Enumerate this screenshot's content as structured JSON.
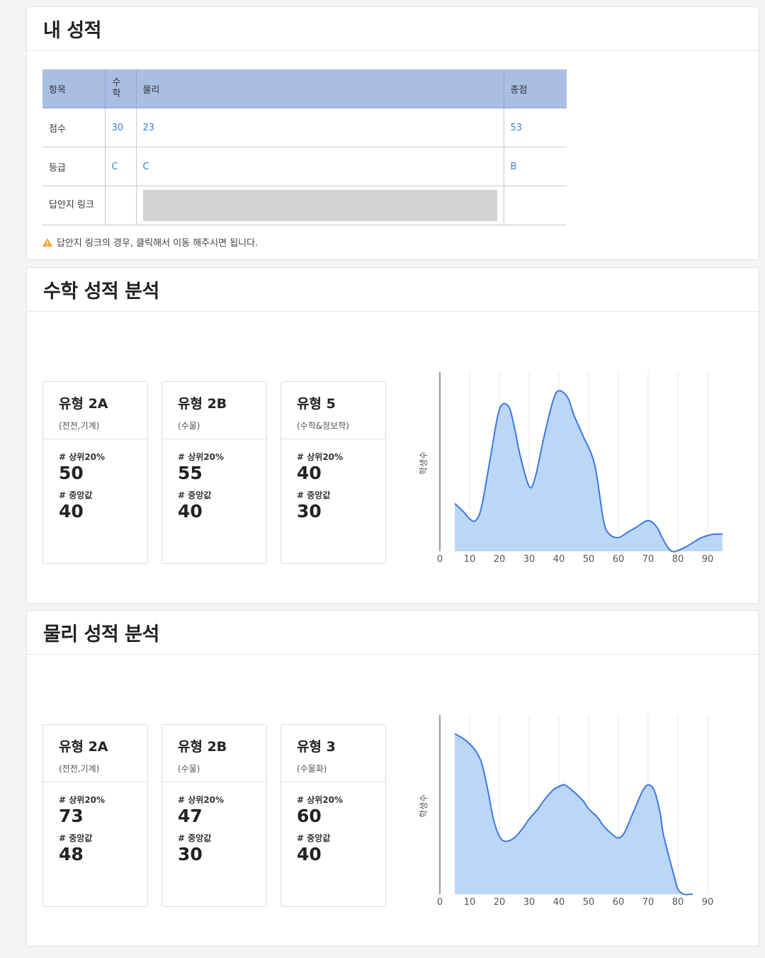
{
  "my_scores": {
    "title": "내 성적",
    "headers": [
      "항목",
      "수학",
      "물리",
      "총점"
    ],
    "rows": [
      {
        "label": "점수",
        "math": "30",
        "physics": "23",
        "total": "53"
      },
      {
        "label": "등급",
        "math": "C",
        "physics": "C",
        "total": "B"
      },
      {
        "label": "답안지 링크",
        "math": "",
        "physics": "",
        "total": ""
      }
    ],
    "notice": "답안지 링크의 경우, 클릭해서 이동 해주시면 됩니다.",
    "notice_icon": "warning-icon"
  },
  "math_analysis": {
    "title": "수학 성적 분석",
    "cards": [
      {
        "title": "유형 2A",
        "subtitle": "(전전,기계)",
        "top20_label": "# 상위20%",
        "top20": "50",
        "median_label": "# 중앙값",
        "median": "40"
      },
      {
        "title": "유형 2B",
        "subtitle": "(수물)",
        "top20_label": "# 상위20%",
        "top20": "55",
        "median_label": "# 중앙값",
        "median": "40"
      },
      {
        "title": "유형 5",
        "subtitle": "(수학&정보학)",
        "top20_label": "# 상위20%",
        "top20": "40",
        "median_label": "# 중앙값",
        "median": "30"
      }
    ]
  },
  "physics_analysis": {
    "title": "물리 성적 분석",
    "cards": [
      {
        "title": "유형 2A",
        "subtitle": "(전전,기계)",
        "top20_label": "# 상위20%",
        "top20": "73",
        "median_label": "# 중앙값",
        "median": "48"
      },
      {
        "title": "유형 2B",
        "subtitle": "(수물)",
        "top20_label": "# 상위20%",
        "top20": "47",
        "median_label": "# 중앙값",
        "median": "30"
      },
      {
        "title": "유형 3",
        "subtitle": "(수물화)",
        "top20_label": "# 상위20%",
        "top20": "60",
        "median_label": "# 중앙값",
        "median": "40"
      }
    ]
  },
  "chart_data": [
    {
      "type": "area",
      "ylabel": "학생수",
      "xlabel": "",
      "x_ticks": [
        "0",
        "10",
        "20",
        "30",
        "40",
        "50",
        "60",
        "70",
        "80",
        "90"
      ],
      "xlim": [
        0,
        95
      ],
      "ylim": [
        0,
        1
      ],
      "grid": true,
      "color": "#3a78e7",
      "fill": "#bcd6f5",
      "x": [
        5,
        8,
        10,
        12,
        14,
        17,
        20,
        23,
        25,
        27,
        30,
        32,
        35,
        38,
        40,
        43,
        45,
        48,
        52,
        55,
        57,
        60,
        63,
        66,
        70,
        73,
        75,
        78,
        82,
        85,
        88,
        92,
        95
      ],
      "y": [
        0.28,
        0.23,
        0.19,
        0.18,
        0.26,
        0.55,
        0.83,
        0.85,
        0.73,
        0.56,
        0.38,
        0.43,
        0.67,
        0.88,
        0.94,
        0.9,
        0.8,
        0.68,
        0.51,
        0.18,
        0.1,
        0.08,
        0.11,
        0.14,
        0.18,
        0.14,
        0.07,
        0.0,
        0.02,
        0.05,
        0.08,
        0.1,
        0.1
      ]
    },
    {
      "type": "area",
      "ylabel": "학생수",
      "xlabel": "",
      "x_ticks": [
        "0",
        "10",
        "20",
        "30",
        "40",
        "50",
        "60",
        "70",
        "80",
        "90"
      ],
      "xlim": [
        0,
        95
      ],
      "ylim": [
        0,
        1
      ],
      "grid": true,
      "color": "#3a78e7",
      "fill": "#bcd6f5",
      "x": [
        5,
        8,
        10,
        12,
        14,
        16,
        18,
        20,
        22,
        25,
        28,
        30,
        33,
        35,
        38,
        40,
        42,
        45,
        48,
        50,
        53,
        55,
        58,
        60,
        62,
        65,
        68,
        70,
        72,
        74,
        75,
        77,
        79,
        80,
        82,
        84,
        85
      ],
      "y": [
        0.94,
        0.91,
        0.88,
        0.84,
        0.77,
        0.62,
        0.44,
        0.34,
        0.31,
        0.33,
        0.39,
        0.44,
        0.5,
        0.55,
        0.61,
        0.63,
        0.64,
        0.6,
        0.55,
        0.5,
        0.45,
        0.4,
        0.35,
        0.33,
        0.36,
        0.48,
        0.6,
        0.64,
        0.61,
        0.48,
        0.36,
        0.22,
        0.09,
        0.03,
        0.0,
        0.0,
        0.0
      ]
    }
  ]
}
